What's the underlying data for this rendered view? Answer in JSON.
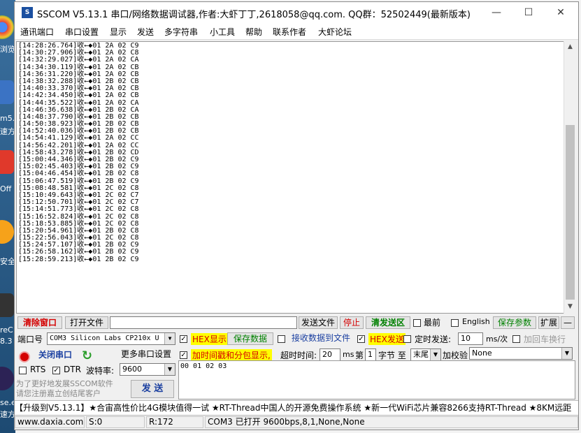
{
  "desktop": {
    "labels": [
      "浏览",
      "m5.1",
      "速方",
      "Off",
      "安全",
      "reC",
      "8.3",
      "se.e",
      "速方"
    ]
  },
  "window": {
    "title": "SSCOM V5.13.1 串口/网络数据调试器,作者:大虾丁丁,2618058@qq.com. QQ群：52502449(最新版本)",
    "controls": {
      "minimize": "—",
      "maximize": "☐",
      "close": "✕"
    }
  },
  "menu": [
    "通讯端口",
    "串口设置",
    "显示",
    "发送",
    "多字符串",
    "小工具",
    "帮助",
    "联系作者",
    "大虾论坛"
  ],
  "receive": {
    "lines": [
      "[14:28:26.764]收←◆01 2A 02 C9",
      "[14:30:27.906]收←◆01 2A 02 C8",
      "[14:32:29.027]收←◆01 2A 02 CA",
      "[14:34:30.119]收←◆01 2A 02 CB",
      "[14:36:31.220]收←◆01 2A 02 CB",
      "[14:38:32.288]收←◆01 2B 02 CB",
      "[14:40:33.370]收←◆01 2A 02 CB",
      "[14:42:34.450]收←◆01 2A 02 CB",
      "[14:44:35.522]收←◆01 2A 02 CA",
      "[14:46:36.638]收←◆01 2B 02 CA",
      "[14:48:37.790]收←◆01 2B 02 CB",
      "[14:50:38.923]收←◆01 2B 02 CB",
      "[14:52:40.036]收←◆01 2B 02 CB",
      "[14:54:41.129]收←◆01 2A 02 CC",
      "[14:56:42.201]收←◆01 2A 02 CC",
      "[14:58:43.278]收←◆01 2B 02 CD",
      "[15:00:44.346]收←◆01 2B 02 C9",
      "[15:02:45.403]收←◆01 2B 02 C9",
      "[15:04:46.454]收←◆01 2B 02 C8",
      "[15:06:47.519]收←◆01 2B 02 C9",
      "[15:08:48.581]收←◆01 2C 02 C8",
      "[15:10:49.643]收←◆01 2C 02 C7",
      "[15:12:50.701]收←◆01 2C 02 C7",
      "[15:14:51.773]收←◆01 2C 02 C8",
      "[15:16:52.824]收←◆01 2C 02 C8",
      "[15:18:53.885]收←◆01 2C 02 C8",
      "[15:20:54.961]收←◆01 2B 02 C8",
      "[15:22:56.043]收←◆01 2C 02 C8",
      "[15:24:57.107]收←◆01 2B 02 C9",
      "[15:26:58.162]收←◆01 2B 02 C9",
      "[15:28:59.213]收←◆01 2B 02 C9"
    ]
  },
  "row1": {
    "clear_window": "清除窗口",
    "open_file": "打开文件",
    "file_path": "",
    "send_file": "发送文件",
    "stop": "停止",
    "clear_send": "清发送区",
    "front_most": "最前",
    "english": "English",
    "save_params": "保存参数",
    "expand": "扩展",
    "collapse": "—"
  },
  "port": {
    "label": "端口号",
    "value": "COM3 Silicon Labs CP210x U",
    "close_port": "关闭串口",
    "more_settings": "更多串口设置",
    "rts": "RTS",
    "dtr": "DTR",
    "baud_label": "波特率:",
    "baud_value": "9600"
  },
  "display": {
    "hex_display": "HEX显示",
    "save_data": "保存数据",
    "recv_to_file": "接收数据到文件",
    "timestamp": "加时间戳和分包显示,",
    "timeout_label": "超时时间:",
    "timeout_value": "20",
    "ms": "ms",
    "byte_label": "第",
    "byte_value": "1",
    "byte_unit": "字节 至",
    "end_value": "末尾",
    "checksum_label": "加校验",
    "checksum_value": "None"
  },
  "send": {
    "hex_send": "HEX发送",
    "timed_send": "定时发送:",
    "interval": "10",
    "unit": "ms/次",
    "add_crlf": "加回车换行",
    "content": "00 01 02 03",
    "send_button": "发 送",
    "promo": "为了更好地发展SSCOM软件\n请您注册嘉立创结尾客户"
  },
  "ticker": "【升级到V5.13.1】★合宙高性价比4G模块值得一试 ★RT-Thread中国人的开源免费操作系统 ★新一代WiFi芯片兼容8266支持RT-Thread ★8KM远距",
  "status": {
    "website": "www.daxia.com",
    "sent": "S:0",
    "received": "R:172",
    "port_state": "COM3 已打开  9600bps,8,1,None,None"
  },
  "colors": {
    "red_text": "#d40000",
    "highlight": "#ffff00",
    "green_text": "#008000",
    "blue_text": "#1a3fa0"
  }
}
